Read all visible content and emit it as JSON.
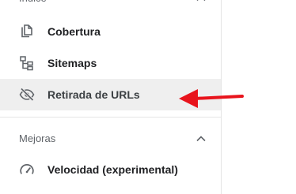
{
  "sidebar": {
    "index_section": {
      "title": "Índice",
      "items": [
        {
          "label": "Cobertura",
          "icon": "copy-pages-icon"
        },
        {
          "label": "Sitemaps",
          "icon": "sitemap-tree-icon"
        },
        {
          "label": "Retirada de URLs",
          "icon": "eye-off-icon",
          "selected": true
        }
      ]
    },
    "enhancements_section": {
      "title": "Mejoras",
      "items": [
        {
          "label": "Velocidad (experimental)",
          "icon": "speed-gauge-icon"
        }
      ]
    }
  },
  "annotation": {
    "type": "red-arrow",
    "points_to": "Retirada de URLs",
    "color": "#e8141c"
  },
  "colors": {
    "selected_row": "#efefef",
    "icon_gray": "#5f6368",
    "divider": "#e4e4e4",
    "text_dark": "#202124"
  }
}
